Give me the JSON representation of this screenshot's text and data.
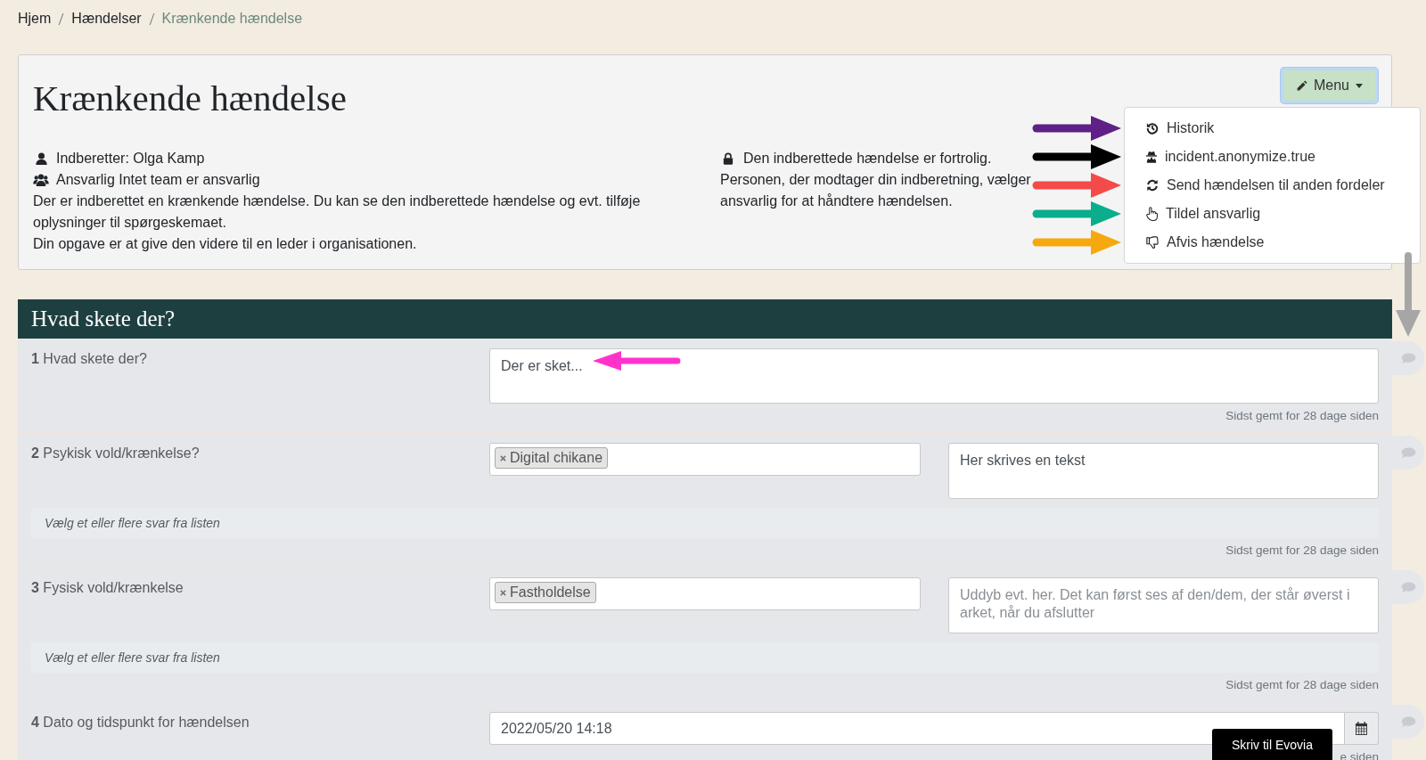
{
  "breadcrumb": [
    {
      "label": "Hjem",
      "current": false
    },
    {
      "label": "Hændelser",
      "current": false
    },
    {
      "label": "Krænkende hændelse",
      "current": true
    }
  ],
  "title": "Krænkende hændelse",
  "menu_button": {
    "label": "Menu",
    "expanded": true
  },
  "menu_items": [
    {
      "label": "Historik",
      "color": "#5f2088"
    },
    {
      "label": "incident.anonymize.true",
      "color": "#000000"
    },
    {
      "label": "Send hændelsen til anden fordeler",
      "color": "#f44a4a"
    },
    {
      "label": "Tildel ansvarlig",
      "color": "#0aae8c"
    },
    {
      "label": "Afvis hændelse",
      "color": "#f5a90f"
    }
  ],
  "info_left": [
    {
      "kind": "reporter",
      "text": "Indberetter: Olga Kamp"
    },
    {
      "kind": "team",
      "text": "Ansvarlig Intet team er ansvarlig"
    },
    {
      "kind": "text",
      "text": "Der er indberettet en krænkende hændelse. Du kan se den indberettede hændelse og evt. tilføje oplysninger til spørgeskemaet."
    },
    {
      "kind": "text",
      "text": "Din opgave er at give den videre til en leder i organisationen."
    }
  ],
  "info_right": [
    {
      "kind": "confidential",
      "text": "Den indberettede hændelse er fortrolig."
    },
    {
      "kind": "text",
      "text": "Personen, der modtager din indberetning, vælger"
    },
    {
      "kind": "text",
      "text": "ansvarlig for at håndtere hændelsen."
    }
  ],
  "section": {
    "title": "Hvad skete der?",
    "questions": [
      {
        "number": "1",
        "label": "Hvad skete der?",
        "kind": "text",
        "value": "Der er sket...",
        "saved": "Sidst gemt for 28 dage siden"
      },
      {
        "number": "2",
        "label": "Psykisk vold/krænkelse?",
        "kind": "tags",
        "tags": [
          "Digital chikane"
        ],
        "note_value": "Her skrives en tekst",
        "hint": "Vælg et eller flere svar fra listen",
        "saved": "Sidst gemt for 28 dage siden"
      },
      {
        "number": "3",
        "label": "Fysisk vold/krænkelse",
        "kind": "tags",
        "tags": [
          "Fastholdelse"
        ],
        "note_placeholder": "Uddyb evt. her. Det kan først ses af den/dem, der står øverst i arket, når du afslutter",
        "hint": "Vælg et eller flere svar fra listen",
        "saved": "Sidst gemt for 28 dage siden"
      },
      {
        "number": "4",
        "label": "Dato og tidspunkt for hændelsen",
        "kind": "date",
        "value": "2022/05/20 14:18",
        "saved": "e siden"
      }
    ]
  },
  "chat_button": "Skriv til Evovia"
}
